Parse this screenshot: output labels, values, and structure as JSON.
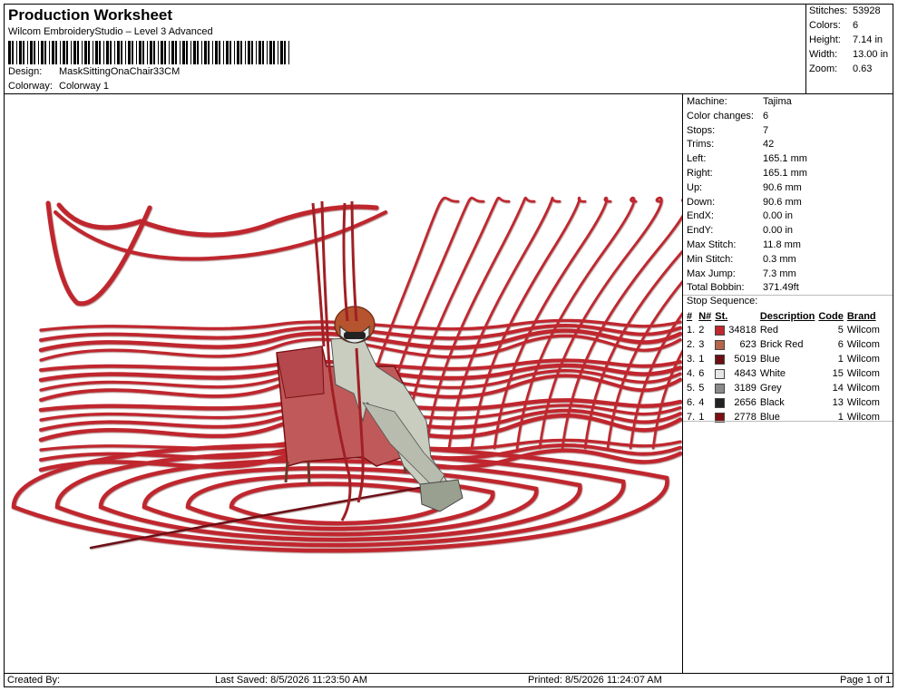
{
  "header": {
    "title": "Production Worksheet",
    "subtitle": "Wilcom EmbroideryStudio – Level 3 Advanced",
    "design_label": "Design:",
    "design_value": "MaskSittingOnaChair33CM",
    "colorway_label": "Colorway:",
    "colorway_value": "Colorway 1"
  },
  "stats": [
    {
      "label": "Stitches:",
      "value": "53928"
    },
    {
      "label": "Colors:",
      "value": "6"
    },
    {
      "label": "Height:",
      "value": "7.14 in"
    },
    {
      "label": "Width:",
      "value": "13.00 in"
    },
    {
      "label": "Zoom:",
      "value": "0.63"
    }
  ],
  "machine_info": [
    {
      "label": "Machine:",
      "value": "Tajima"
    },
    {
      "label": "Color changes:",
      "value": "6"
    },
    {
      "label": "Stops:",
      "value": "7"
    },
    {
      "label": "Trims:",
      "value": "42"
    },
    {
      "label": "Left:",
      "value": "165.1 mm"
    },
    {
      "label": "Right:",
      "value": "165.1 mm"
    },
    {
      "label": "Up:",
      "value": "90.6 mm"
    },
    {
      "label": "Down:",
      "value": "90.6 mm"
    },
    {
      "label": "EndX:",
      "value": "0.00 in"
    },
    {
      "label": "EndY:",
      "value": "0.00 in"
    },
    {
      "label": "Max Stitch:",
      "value": "11.8 mm"
    },
    {
      "label": "Min Stitch:",
      "value": "0.3 mm"
    },
    {
      "label": "Max Jump:",
      "value": "7.3 mm"
    },
    {
      "label": "Total Bobbin:",
      "value": "371.49ft"
    }
  ],
  "stop_sequence": {
    "title": "Stop Sequence:",
    "columns": [
      "#",
      "N#",
      "St.",
      "Description",
      "Code",
      "Brand"
    ],
    "rows": [
      {
        "idx": "1.",
        "n": "2",
        "color": "#c0282d",
        "st": "34818",
        "desc": "Red",
        "code": "5",
        "brand": "Wilcom"
      },
      {
        "idx": "2.",
        "n": "3",
        "color": "#b5654a",
        "st": "623",
        "desc": "Brick Red",
        "code": "6",
        "brand": "Wilcom"
      },
      {
        "idx": "3.",
        "n": "1",
        "color": "#6b0f12",
        "st": "5019",
        "desc": "Blue",
        "code": "1",
        "brand": "Wilcom"
      },
      {
        "idx": "4.",
        "n": "6",
        "color": "#e6e6e6",
        "st": "4843",
        "desc": "White",
        "code": "15",
        "brand": "Wilcom"
      },
      {
        "idx": "5.",
        "n": "5",
        "color": "#8a8a8a",
        "st": "3189",
        "desc": "Grey",
        "code": "14",
        "brand": "Wilcom"
      },
      {
        "idx": "6.",
        "n": "4",
        "color": "#222222",
        "st": "2656",
        "desc": "Black",
        "code": "13",
        "brand": "Wilcom"
      },
      {
        "idx": "7.",
        "n": "1",
        "color": "#7a1014",
        "st": "2778",
        "desc": "Blue",
        "code": "1",
        "brand": "Wilcom"
      }
    ]
  },
  "footer": {
    "created_by": "Created By:",
    "last_saved": "Last Saved: 8/5/2026 11:23:50 AM",
    "printed": "Printed: 8/5/2026 11:24:07 AM",
    "page": "Page 1 of 1"
  }
}
